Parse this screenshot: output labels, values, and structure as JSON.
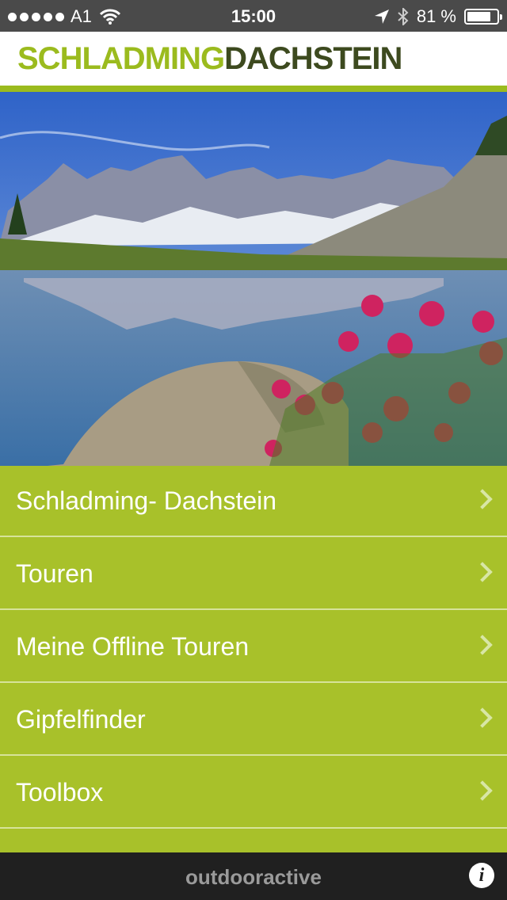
{
  "status_bar": {
    "carrier": "A1",
    "time": "15:00",
    "battery_percent_text": "81 %",
    "battery_level": 0.81,
    "icons": [
      "signal-dots-icon",
      "wifi-icon",
      "location-arrow-icon",
      "bluetooth-icon",
      "battery-icon"
    ]
  },
  "header": {
    "logo_part1": "SCHLADMING",
    "logo_part2": "DACHSTEIN"
  },
  "hero": {
    "image": "alpine-lake-mountain-photo"
  },
  "menu": {
    "items": [
      {
        "label": "Schladming- Dachstein"
      },
      {
        "label": "Touren"
      },
      {
        "label": "Meine Offline Touren"
      },
      {
        "label": "Gipfelfinder"
      },
      {
        "label": "Toolbox"
      }
    ]
  },
  "footer": {
    "brand": "outdooractive",
    "info_glyph": "i"
  },
  "colors": {
    "accent": "#9bbb1e",
    "menu_bg": "#a8c12a",
    "footer_bg": "#202020",
    "status_bg": "#4a4a4a"
  }
}
